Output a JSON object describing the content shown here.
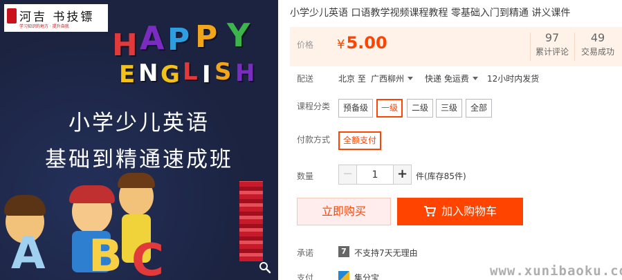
{
  "gallery": {
    "logo_text": "河吉  书技镖",
    "logo_subtext": "学习知识的地方 · 提升自我",
    "happy_letters": [
      "H",
      "A",
      "P",
      "P",
      "Y"
    ],
    "english_letters": [
      "E",
      "N",
      "G",
      "L",
      "I",
      "S",
      "H"
    ],
    "headline_line1": "小学少儿英语",
    "headline_line2": "基础到精通速成班",
    "abc_letters": [
      "A",
      "B",
      "C"
    ]
  },
  "product": {
    "title": "小学少儿英语 口语教学视频课程教程 零基础入门到精通 讲义课件"
  },
  "price": {
    "label": "价格",
    "currency": "¥",
    "value": "5.00",
    "reviews_count": "97",
    "reviews_label": "累计评论",
    "deals_count": "49",
    "deals_label": "交易成功"
  },
  "shipping": {
    "label": "配送",
    "from": "北京 至",
    "to": "广西柳州",
    "method": "快递 免运费",
    "dispatch": "12小时内发货"
  },
  "category": {
    "label": "课程分类",
    "options": [
      "预备级",
      "一级",
      "二级",
      "三级",
      "全部"
    ],
    "selected": "一级"
  },
  "payment": {
    "label": "付款方式",
    "option": "全额支付"
  },
  "quantity": {
    "label": "数量",
    "value": "1",
    "minus": "−",
    "plus": "+",
    "stock_text": "件(库存85件)"
  },
  "actions": {
    "buy_now": "立即购买",
    "add_to_cart": "加入购物车"
  },
  "promise": {
    "label": "承诺",
    "icon_text": "7",
    "text": "不支持7天无理由"
  },
  "pay": {
    "label": "支付",
    "text": "集分宝"
  },
  "watermark": "www.xunibaoku.com",
  "colors": {
    "accent": "#ff4400",
    "price_bg": "#fff2e8",
    "buy_now_bg": "#ffeded",
    "image_bg": "#1b2340"
  }
}
